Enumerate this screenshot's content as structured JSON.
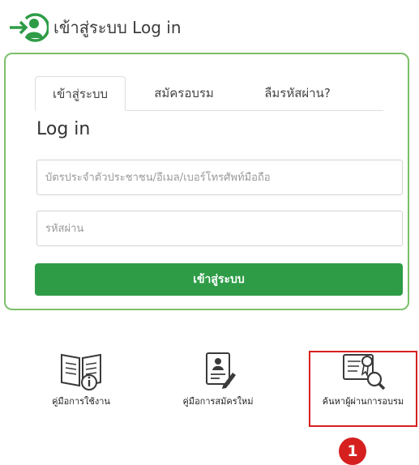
{
  "header": {
    "title": "เข้าสู่ระบบ Log in",
    "icon": "login-user-icon"
  },
  "tabs": [
    {
      "label": "เข้าสู่ระบบ",
      "active": true
    },
    {
      "label": "สมัครอบรม",
      "active": false
    },
    {
      "label": "ลืมรหัสผ่าน?",
      "active": false
    }
  ],
  "form": {
    "title": "Log in",
    "id_placeholder": "บัตรประจำตัวประชาชน/อีเมล/เบอร์โทรศัพท์มือถือ",
    "password_placeholder": "รหัสผ่าน",
    "submit_label": "เข้าสู่ระบบ"
  },
  "links": [
    {
      "label": "คู่มือการใช้งาน",
      "icon": "manual-book-icon"
    },
    {
      "label": "คู่มือการสมัครใหม่",
      "icon": "registration-form-icon"
    },
    {
      "label": "ค้นหาผู้ผ่านการอบรม",
      "icon": "certificate-search-icon"
    }
  ],
  "annotation": {
    "marker": "1",
    "color": "#d62020"
  },
  "colors": {
    "brand_green": "#2e9c47",
    "border_green": "#7cbf6a"
  }
}
